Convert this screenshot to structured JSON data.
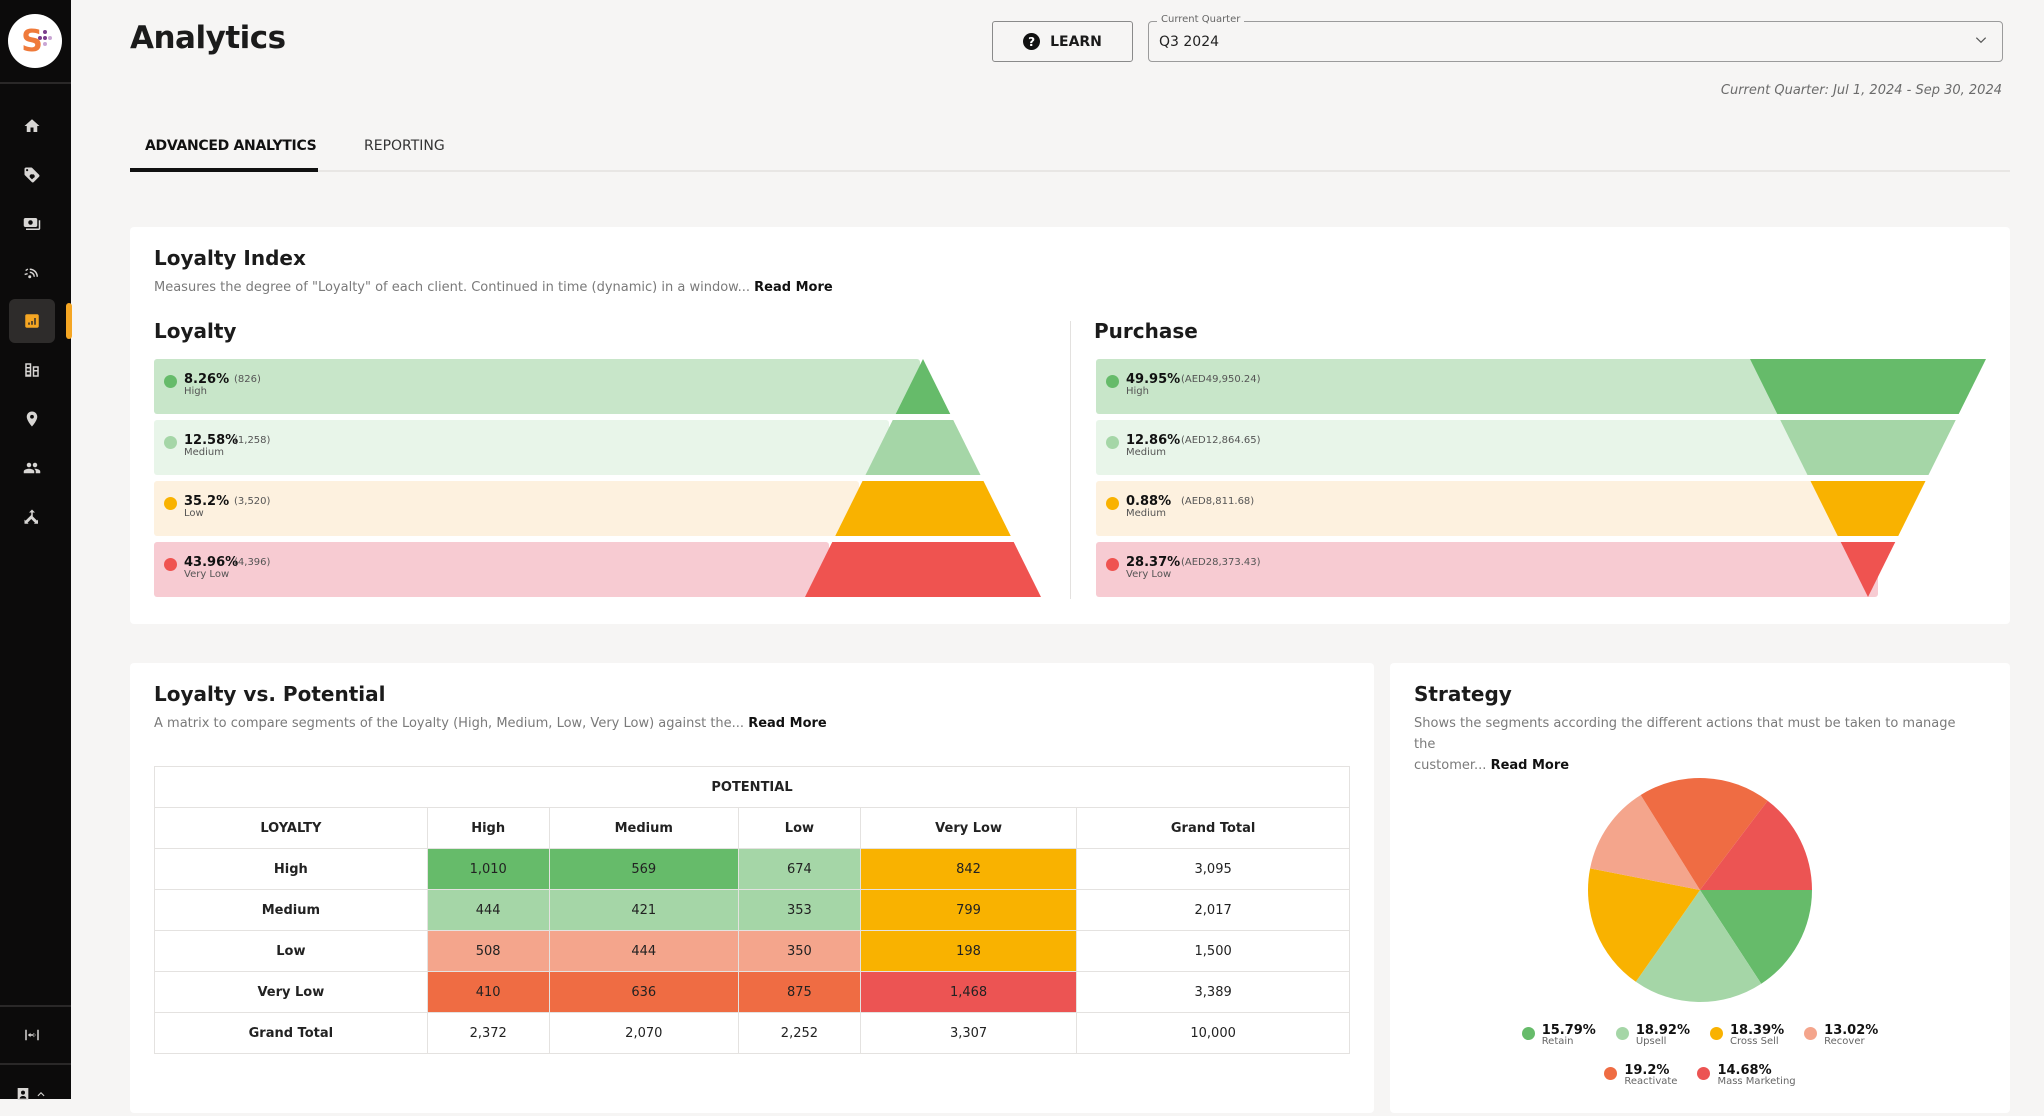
{
  "sidebar": {
    "logo": "S",
    "items": [
      {
        "icon": "home-icon",
        "active": false
      },
      {
        "icon": "tag-heart-icon",
        "active": false
      },
      {
        "icon": "cash-icon",
        "active": false
      },
      {
        "icon": "signal-icon",
        "active": false
      },
      {
        "icon": "analytics-chart-icon",
        "active": true
      },
      {
        "icon": "catalog-icon",
        "active": false
      },
      {
        "icon": "location-pin-icon",
        "active": false
      },
      {
        "icon": "users-icon",
        "active": false
      },
      {
        "icon": "merge-icon",
        "active": false
      }
    ],
    "bottom": [
      "expand-width-icon",
      "account-icon",
      "chevron-up-icon"
    ],
    "accent": "#f5a623"
  },
  "header": {
    "title": "Analytics",
    "learn_label": "LEARN",
    "quarter_label": "Current Quarter",
    "quarter_value": "Q3 2024",
    "quarter_range": "Current Quarter: Jul 1, 2024 - Sep 30, 2024"
  },
  "tabs": [
    {
      "label": "ADVANCED ANALYTICS",
      "active": true
    },
    {
      "label": "REPORTING",
      "active": false
    }
  ],
  "loyalty_index": {
    "title": "Loyalty Index",
    "description": "Measures the degree of \"Loyalty\" of each client. Continued in time (dynamic) in a window...",
    "read_more": "Read More",
    "loyalty": {
      "title": "Loyalty",
      "rows": [
        {
          "pct": "8.26%",
          "count": "(826)",
          "label": "High",
          "color": "#66bb6a",
          "bg": "#c8e6c9"
        },
        {
          "pct": "12.58%",
          "count": "(1,258)",
          "label": "Medium",
          "color": "#a5d6a7",
          "bg": "#e8f5e9"
        },
        {
          "pct": "35.2%",
          "count": "(3,520)",
          "label": "Low",
          "color": "#f9b200",
          "bg": "#fdf1df"
        },
        {
          "pct": "43.96%",
          "count": "(4,396)",
          "label": "Very Low",
          "color": "#ef5350",
          "bg": "#f7cbd2"
        }
      ]
    },
    "purchase": {
      "title": "Purchase",
      "rows": [
        {
          "pct": "49.95%",
          "count": "(AED49,950.24)",
          "label": "High",
          "color": "#66bb6a",
          "bg": "#c8e6c9"
        },
        {
          "pct": "12.86%",
          "count": "(AED12,864.65)",
          "label": "Medium",
          "color": "#a5d6a7",
          "bg": "#e8f5e9"
        },
        {
          "pct": "0.88%",
          "count": "(AED8,811.68)",
          "label": "Medium",
          "color": "#f9b200",
          "bg": "#fdf1df"
        },
        {
          "pct": "28.37%",
          "count": "(AED28,373.43)",
          "label": "Very Low",
          "color": "#ef5350",
          "bg": "#f7cbd2"
        }
      ]
    }
  },
  "loyalty_vs_potential": {
    "title": "Loyalty vs. Potential",
    "description": "A matrix to compare segments of the Loyalty (High, Medium, Low, Very Low) against the...",
    "read_more": "Read More",
    "potential_header": "POTENTIAL",
    "columns": [
      "LOYALTY",
      "High",
      "Medium",
      "Low",
      "Very Low",
      "Grand Total"
    ],
    "rows": [
      {
        "label": "High",
        "cells": [
          "1,010",
          "569",
          "674",
          "842"
        ],
        "total": "3,095",
        "colors": [
          "#66bb6a",
          "#66bb6a",
          "#a5d6a7",
          "#f9b200"
        ]
      },
      {
        "label": "Medium",
        "cells": [
          "444",
          "421",
          "353",
          "799"
        ],
        "total": "2,017",
        "colors": [
          "#a5d6a7",
          "#a5d6a7",
          "#a5d6a7",
          "#f9b200"
        ]
      },
      {
        "label": "Low",
        "cells": [
          "508",
          "444",
          "350",
          "198"
        ],
        "total": "1,500",
        "colors": [
          "#f4a58c",
          "#f4a58c",
          "#f4a58c",
          "#f9b200"
        ]
      },
      {
        "label": "Very Low",
        "cells": [
          "410",
          "636",
          "875",
          "1,468"
        ],
        "total": "3,389",
        "colors": [
          "#ef6c43",
          "#ef6c43",
          "#ef6c43",
          "#ec5453"
        ]
      }
    ],
    "grand_total": {
      "label": "Grand Total",
      "cells": [
        "2,372",
        "2,070",
        "2,252",
        "3,307"
      ],
      "total": "10,000"
    }
  },
  "strategy": {
    "title": "Strategy",
    "description_1": "Shows the segments according the different actions that must be taken to manage the",
    "description_2": "customer...",
    "read_more": "Read More"
  },
  "chart_data": {
    "type": "pie",
    "title": "Strategy",
    "categories": [
      "Retain",
      "Upsell",
      "Cross Sell",
      "Recover",
      "Reactivate",
      "Mass Marketing"
    ],
    "values": [
      15.79,
      18.92,
      18.39,
      13.02,
      19.2,
      14.68
    ],
    "labels": [
      "15.79%",
      "18.92%",
      "18.39%",
      "13.02%",
      "19.2%",
      "14.68%"
    ],
    "colors": [
      "#66bb6a",
      "#a5d6a7",
      "#f9b200",
      "#f4a58c",
      "#ef6c43",
      "#ec5453"
    ],
    "start": "3 o'clock, clockwise",
    "legend": "bottom"
  }
}
